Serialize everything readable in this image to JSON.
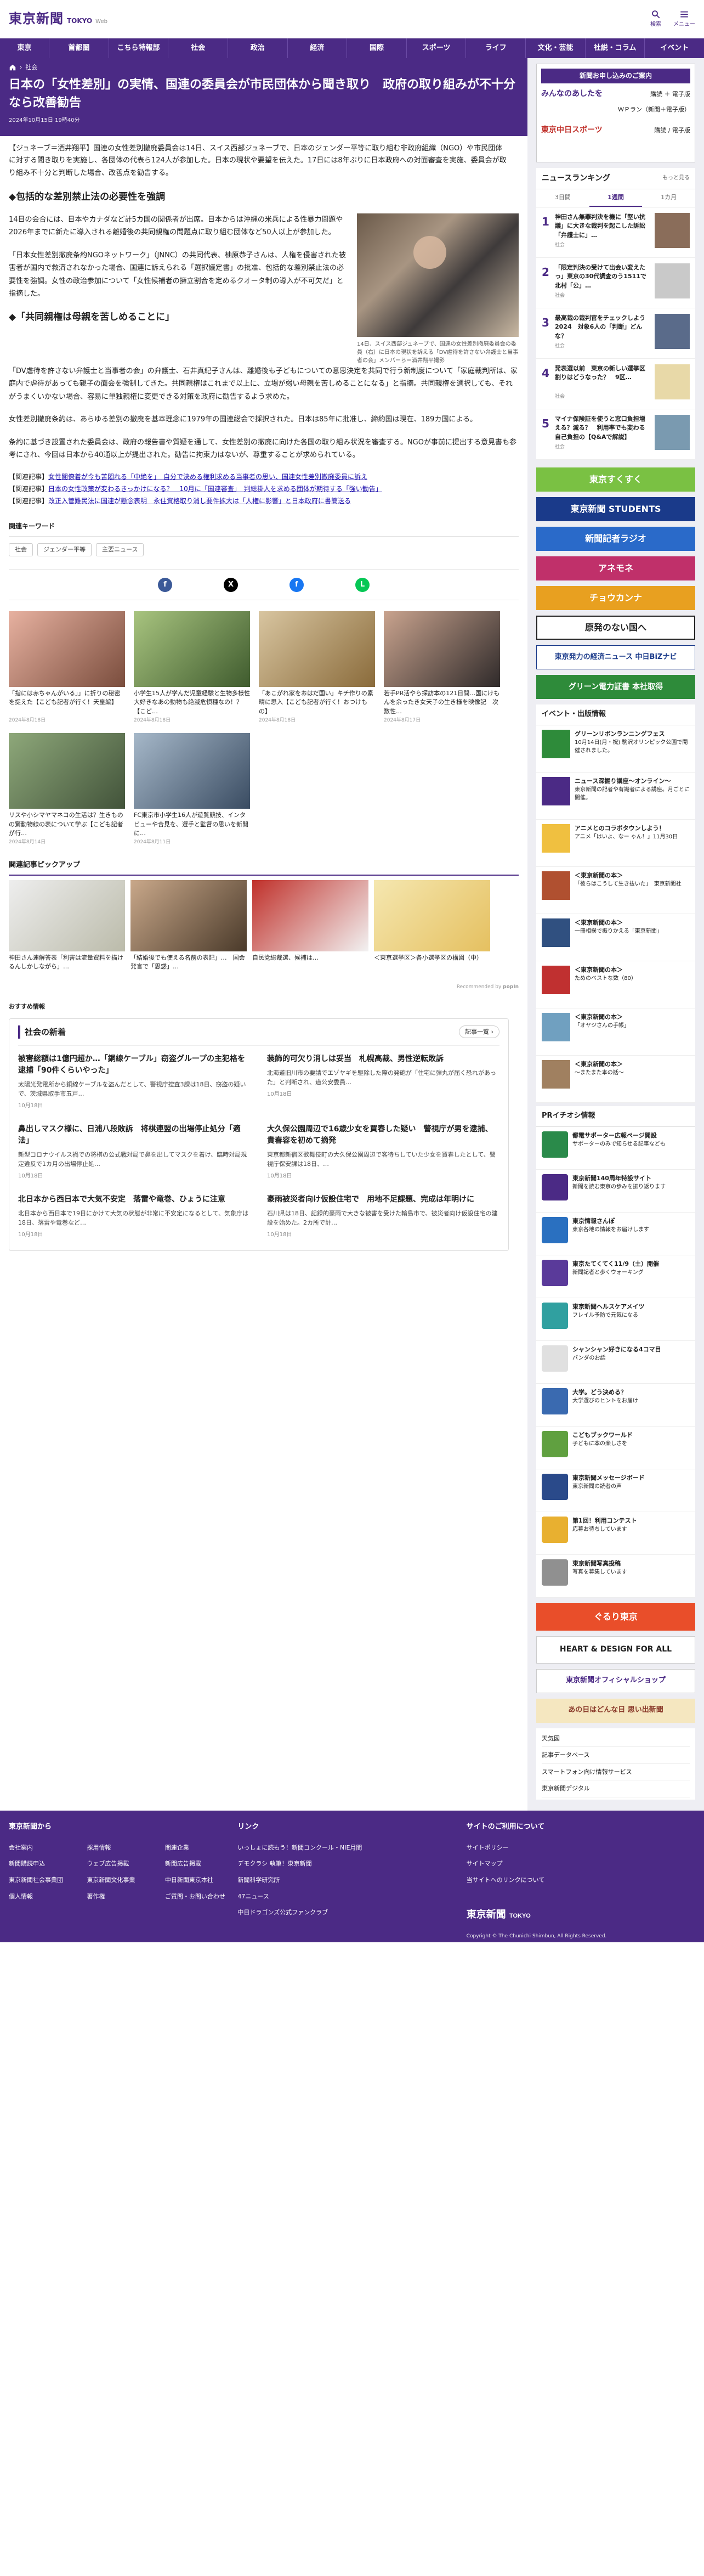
{
  "header": {
    "logo_jp": "東京新聞",
    "logo_en": "TOKYO",
    "logo_web": "Web",
    "search": "検索",
    "menu": "メニュー"
  },
  "nav": [
    "東京",
    "首都圏",
    "こちら特報部",
    "社会",
    "政治",
    "経済",
    "国際",
    "スポーツ",
    "ライフ",
    "文化・芸能",
    "社説・コラム",
    "イベント"
  ],
  "breadcrumb": "社会",
  "article": {
    "title": "日本の「女性差別」の実情、国連の委員会が市民団体から聞き取り　政府の取り組みが不十分なら改善勧告",
    "date": "2024年10月15日 19時40分",
    "lead": "【ジュネーブ＝酒井翔平】国連の女性差別撤廃委員会は14日、スイス西部ジュネーブで、日本のジェンダー平等に取り組む非政府組織（NGO）や市民団体に対する聞き取りを実施し、各団体の代表ら124人が参加した。日本の現状や要望を伝えた。17日には8年ぶりに日本政府への対面審査を実施、委員会が取り組み不十分と判断した場合、改善点を勧告する。",
    "h1": "◆包括的な差別禁止法の必要性を強調",
    "p1": "14日の会合には、日本やカナダなど計5カ国の関係者が出席。日本からは沖縄の米兵による性暴力問題や2026年までに新たに導入される離婚後の共同親権の問題点に取り組む団体など50人以上が参加した。",
    "p2": "「日本女性差別撤廃条約NGOネットワーク」（JNNC）の共同代表、柚原恭子さんは、人権を侵害された被害者が国内で救済されなかった場合、国連に訴えられる「選択議定書」の批准、包括的な差別禁止法の必要性を強調。女性の政治参加について「女性候補者の擁立割合を定めるクオータ制の導入が不可欠だ」と指摘した。",
    "h2": "◆「共同親権は母親を苦しめることに」",
    "p3": "「DV虐待を許さない弁護士と当事者の会」の弁護士、石井真紀子さんは、離婚後も子どもについての意思決定を共同で行う新制度について「家庭裁判所は、家庭内で虐待があっても親子の面会を強制してきた。共同親権はこれまで以上に、立場が弱い母親を苦しめることになる」と指摘。共同親権を選択しても、それがうまくいかない場合、容易に単独親権に変更できる対策を政府に勧告するよう求めた。",
    "p4": "女性差別撤廃条約は、あらゆる差別の撤廃を基本理念に1979年の国連総会で採択された。日本は85年に批准し、締約国は現在、189カ国による。",
    "p5": "条約に基づき設置された委員会は、政府の報告書や質疑を通して、女性差別の撤廃に向けた各国の取り組み状況を審査する。NGOが事前に提出する意見書も参考にされ、今回は日本から40通以上が提出された。勧告に拘束力はないが、尊重することが求められている。",
    "caption": "14日、スイス西部ジュネーブで、国連の女性差別撤廃委員会の委員（右）に日本の現状を訴える「DV虐待を許さない弁護士と当事者の会」メンバーら＝酒井翔平撮影",
    "related": [
      {
        "label": "【関連記事】",
        "text": "女性閣僚着が今も苦悶れる「中絶を」　自分で決める権利求める当事者の思い、国連女性差別撤廃委員に訴え"
      },
      {
        "label": "【関連記事】",
        "text": "日本の女性政策が変わるきっかけになる？　10月に「国連審査」　判総掛人を求める団体が期待する「強い勧告」"
      },
      {
        "label": "【関連記事】",
        "text": "改正入管難民法に国連が懸念表明　永住資格取り消し要件拡大は「人権に影響」と日本政府に書簡送る"
      }
    ]
  },
  "keywords": {
    "title": "関連キーワード",
    "items": [
      "社会",
      "ジェンダー平等",
      "主要ニュース"
    ]
  },
  "share": [
    "Facebook",
    "X",
    "Facebook",
    "LINE"
  ],
  "related_thumbs": [
    {
      "title": "「指には赤ちゃんがいる」」に折りの秘密を捉えた【こども記者が行く！天皇編】",
      "date": "2024年8月18日"
    },
    {
      "title": "小学生15人が学んだ児童経験と生物多様性　大好きなあの動物も絶滅危惧種なの！？【こど…",
      "date": "2024年8月18日"
    },
    {
      "title": "「あこがれ家をおはだ国い」キチ作りの素晴に思入【こども記者が行く！おつけもの】",
      "date": "2024年8月18日"
    },
    {
      "title": "若手PR活やら探訪本の121日間…国にけもんを余ったき女天子の生き様を映像記　次数性…",
      "date": "2024年8月17日"
    },
    {
      "title": "リスや小シマヤマネコの生活は？生きものの驚動物線の表について学ぶ【こども記者が行…",
      "date": "2024年8月14日"
    },
    {
      "title": "FC東京市小学生16人が遊覧競技、インタビューや合見を、選手と監督の思いを新聞に…",
      "date": "2024年8月11日"
    }
  ],
  "pickup": {
    "title": "関連記事ピックアップ",
    "items": [
      {
        "title": "神田さん連解答表「利害は流量資料を描けるんしかしながら」…"
      },
      {
        "title": "「結婚後でも使える名前の表記」…　国会発言で「思惑」…"
      },
      {
        "title": "自民党総裁選、候補は…"
      },
      {
        "title": "＜東京選挙区＞各小選挙区の構図（中）"
      }
    ],
    "recommended": "Recommended by",
    "recommend_brand": "popIn"
  },
  "osusume": "おすすめ情報",
  "shakai": {
    "title": "社会の新着",
    "more": "記事一覧",
    "items": [
      {
        "h": "被害総額は1億円超か…「銅線ケーブル」窃盗グループの主犯格を逮捕「90件くらいやった」",
        "b": "太陽光発電所から銅線ケーブルを盗んだとして、警視庁捜査3課は18日、窃盗の疑いで、茨城県取手市五戸…",
        "d": "10月18日"
      },
      {
        "h": "装飾的可欠り消しは妥当　札幌高裁、男性逆転敗訴",
        "b": "北海道旧川市の要請でエゾヤギを駆除した際の発砲が「住宅に弾丸が届く恐れがあった」と判断され、道公安委員…",
        "d": "10月18日"
      },
      {
        "h": "鼻出しマスク様に、日浦八段敗訴　将棋連盟の出場停止処分「適法」",
        "b": "新型コロナウイルス禍での将棋の公式戦対局で鼻を出してマスクを着け、臨時対局規定違反で1カ月の出場停止処…",
        "d": "10月18日"
      },
      {
        "h": "大久保公園周辺で16歳少女を買春した疑い　警視庁が男を逮捕、貴春容を初めて摘発",
        "b": "東京都新宿区歌舞伎町の大久保公園周辺で客待ちしていた少女を買春したとして、警視庁保安課は18日、…",
        "d": "10月18日"
      },
      {
        "h": "北日本から西日本で大気不安定　落雷や竜巻、ひょうに注意",
        "b": "北日本から西日本で19日にかけて大気の状態が非常に不安定になるとして、気象庁は18日、落雷や竜巻など…",
        "d": "10月18日"
      },
      {
        "h": "豪雨被災者向け仮設住宅で　用地不足課題、完成は年明けに",
        "b": "石川県は18日、記録的豪雨で大きな被害を受けた輪島市で、被災者向け仮設住宅の建設を始めた。2カ所で計…",
        "d": "10月18日"
      }
    ]
  },
  "sidebar": {
    "top_banner": {
      "title": "新聞お申し込みのご案内",
      "row1_brand": "みんなのあしたを",
      "row1_a": "購読 ＋ 電子版",
      "row1_b": "ＷＰラン（新聞＋電子版）",
      "row2_brand": "東京中日スポーツ",
      "row2_a": "購読",
      "row2_b": "電子版"
    },
    "ranking": {
      "title": "ニュースランキング",
      "more": "もっと見る",
      "tabs": [
        "3日間",
        "1週間",
        "1カ月"
      ],
      "items": [
        {
          "n": "1",
          "t": "神田さん無罪判決を機に「堅い抗議」に大きな裁判を起こした訴訟「弁護士に」…",
          "c": "社会"
        },
        {
          "n": "2",
          "t": "「限定判決の受けて出会い変えたっ」東京の30代調査のう1511で北村「公」…",
          "c": "社会"
        },
        {
          "n": "3",
          "t": "最高裁の裁判官をチェックしよう2024　対象6人の「判断」どんな？",
          "c": "社会"
        },
        {
          "n": "4",
          "t": "発表選以前　東京の新しい選挙区割りはどうなった？　9区…",
          "c": "社会"
        },
        {
          "n": "5",
          "t": "マイナ保険証を使うと窓口負担増える？減る？　利用率でも変わる自己負担の【Q&Aで解説】",
          "c": "社会"
        }
      ]
    },
    "banners": [
      "東京すくすく",
      "東京新聞 STUDENTS",
      "新聞記者ラジオ",
      "アネモネ",
      "チョウカンナ",
      "原発のない国へ",
      "東京発力の経済ニュース 中日BiZナビ",
      "グリーン電力証書 本社取得"
    ],
    "events": {
      "title": "イベント・出版情報",
      "items": [
        {
          "b": "グリーンリボンランニングフェス",
          "t": "10月14日(月・祝) 駒沢オリンピック公園で開催されました。"
        },
        {
          "b": "ニュース深掘り講座〜オンライン〜",
          "t": "東京新聞の記者や有識者による講座。月ごとに開催。"
        },
        {
          "b": "アニメとのコラボタウンしよう！",
          "t": "アニメ「はいよ、なー ゃん！」11月30日"
        },
        {
          "b": "＜東京新聞の本＞",
          "t": "「彼らはこうして生き抜いた」　東京新聞社"
        },
        {
          "b": "＜東京新聞の本＞",
          "t": "一冊相撲で振りかえる「東京新聞」"
        },
        {
          "b": "＜東京新聞の本＞",
          "t": "ためのベストな数（80）"
        },
        {
          "b": "＜東京新聞の本＞",
          "t": "「オヤジさんの手帳」"
        },
        {
          "b": "＜東京新聞の本＞",
          "t": "〜またまた本の話〜"
        }
      ]
    },
    "pr": {
      "title": "PRイチオシ情報",
      "items": [
        {
          "b": "都電サポーター広報ページ開設",
          "t": "サポーターのみで知らせる記事なども"
        },
        {
          "b": "東京新聞140周年特設サイト",
          "t": "新聞を読む東京の歩みを振り返ります"
        },
        {
          "b": "東京情報さんぽ",
          "t": "東京各地の情報をお届けします"
        },
        {
          "b": "東京たてくてく11/9（土）開催",
          "t": "新聞記者と歩くウォーキング"
        },
        {
          "b": "東京新聞ヘルスケアメイツ",
          "t": "フレイル予防で元気になる"
        },
        {
          "b": "シャンシャン好きになる4コマ目",
          "t": "パンダのお話"
        },
        {
          "b": "大学。どう決める？",
          "t": "大学選びのヒントをお届け"
        },
        {
          "b": "こどもブックワールド",
          "t": "子どもに本の楽しさを"
        },
        {
          "b": "東京新聞メッセージボード",
          "t": "東京新聞の読者の声"
        },
        {
          "b": "第1回！利用コンテスト",
          "t": "応募お待ちしています"
        },
        {
          "b": "東京新聞写真投稿",
          "t": "写真を募集しています"
        }
      ]
    },
    "bottom_banners": [
      "ぐるり東京",
      "HEART & DESIGN FOR ALL",
      "東京新聞オフィシャルショップ",
      "あの日はどんな日 思い出新聞"
    ],
    "bottom_links": [
      "天気図",
      "記事データベース",
      "スマートフォン向け情報サービス",
      "東京新聞デジタル"
    ]
  },
  "footer": {
    "col1": {
      "title": "東京新聞から",
      "links": [
        "会社案内",
        "採用情報",
        "関連企業",
        "新聞購読申込",
        "ウェブ広告掲載",
        "新聞広告掲載",
        "東京新聞社会事業団",
        "東京新聞文化事業",
        "中日新聞東京本社",
        "個人情報",
        "著作権",
        "ご質問・お問い合わせ"
      ]
    },
    "col2": {
      "title": "リンク",
      "links": [
        "いっしょに読もう！新聞コンクール・NIE月間",
        "デモクラシ 執筆！東京新聞",
        "新聞科学研究所",
        "47ニュース",
        "中日ドラゴンズ公式ファンクラブ"
      ]
    },
    "col3": {
      "title": "サイトのご利用について",
      "links": [
        "サイトポリシー",
        "サイトマップ",
        "当サイトへのリンクについて"
      ]
    },
    "copyright": "Copyright © The Chunichi Shimbun, All Rights Reserved."
  }
}
